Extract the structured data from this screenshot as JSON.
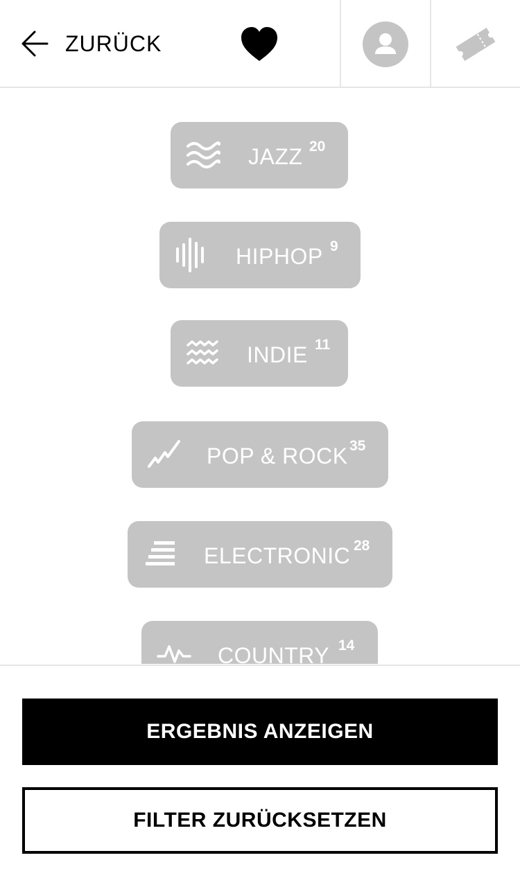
{
  "header": {
    "back_label": "ZURÜCK",
    "back_icon": "arrow-left-icon",
    "favorites_icon": "heart-icon",
    "account_icon": "user-icon",
    "tickets_icon": "ticket-icon"
  },
  "genres": [
    {
      "label": "JAZZ",
      "count": "20",
      "icon": "waves-icon"
    },
    {
      "label": "HIPHOP",
      "count": "9",
      "icon": "soundwave-icon"
    },
    {
      "label": "INDIE",
      "count": "11",
      "icon": "zigzag-waves-icon"
    },
    {
      "label": "POP & ROCK",
      "count": "35",
      "icon": "trend-line-icon"
    },
    {
      "label": "ELECTRONIC",
      "count": "28",
      "icon": "stacked-lines-icon"
    },
    {
      "label": "COUNTRY",
      "count": "14",
      "icon": "pulse-icon"
    }
  ],
  "actions": {
    "show_results": "ERGEBNIS ANZEIGEN",
    "reset_filters": "FILTER ZURÜCKSETZEN"
  },
  "colors": {
    "chip_bg": "#c4c4c4",
    "chip_text": "#ffffff",
    "primary": "#000000",
    "divider": "#e6e6e6"
  }
}
